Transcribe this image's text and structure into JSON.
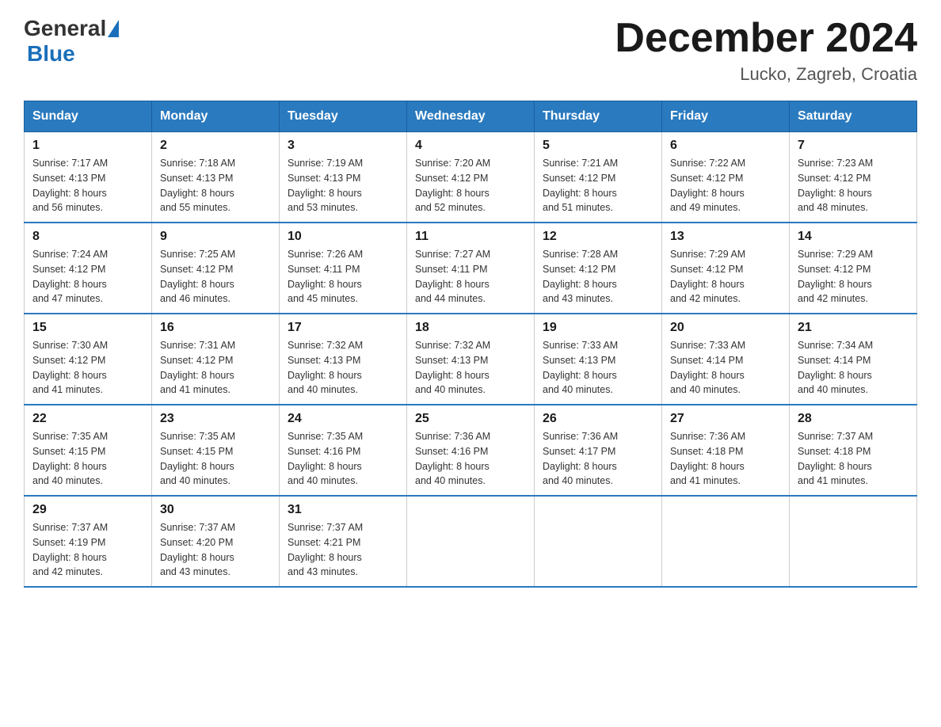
{
  "header": {
    "logo_general": "General",
    "logo_blue": "Blue",
    "title": "December 2024",
    "location": "Lucko, Zagreb, Croatia"
  },
  "calendar": {
    "days_of_week": [
      "Sunday",
      "Monday",
      "Tuesday",
      "Wednesday",
      "Thursday",
      "Friday",
      "Saturday"
    ],
    "weeks": [
      [
        {
          "date": "1",
          "sunrise": "7:17 AM",
          "sunset": "4:13 PM",
          "daylight": "8 hours and 56 minutes."
        },
        {
          "date": "2",
          "sunrise": "7:18 AM",
          "sunset": "4:13 PM",
          "daylight": "8 hours and 55 minutes."
        },
        {
          "date": "3",
          "sunrise": "7:19 AM",
          "sunset": "4:13 PM",
          "daylight": "8 hours and 53 minutes."
        },
        {
          "date": "4",
          "sunrise": "7:20 AM",
          "sunset": "4:12 PM",
          "daylight": "8 hours and 52 minutes."
        },
        {
          "date": "5",
          "sunrise": "7:21 AM",
          "sunset": "4:12 PM",
          "daylight": "8 hours and 51 minutes."
        },
        {
          "date": "6",
          "sunrise": "7:22 AM",
          "sunset": "4:12 PM",
          "daylight": "8 hours and 49 minutes."
        },
        {
          "date": "7",
          "sunrise": "7:23 AM",
          "sunset": "4:12 PM",
          "daylight": "8 hours and 48 minutes."
        }
      ],
      [
        {
          "date": "8",
          "sunrise": "7:24 AM",
          "sunset": "4:12 PM",
          "daylight": "8 hours and 47 minutes."
        },
        {
          "date": "9",
          "sunrise": "7:25 AM",
          "sunset": "4:12 PM",
          "daylight": "8 hours and 46 minutes."
        },
        {
          "date": "10",
          "sunrise": "7:26 AM",
          "sunset": "4:11 PM",
          "daylight": "8 hours and 45 minutes."
        },
        {
          "date": "11",
          "sunrise": "7:27 AM",
          "sunset": "4:11 PM",
          "daylight": "8 hours and 44 minutes."
        },
        {
          "date": "12",
          "sunrise": "7:28 AM",
          "sunset": "4:12 PM",
          "daylight": "8 hours and 43 minutes."
        },
        {
          "date": "13",
          "sunrise": "7:29 AM",
          "sunset": "4:12 PM",
          "daylight": "8 hours and 42 minutes."
        },
        {
          "date": "14",
          "sunrise": "7:29 AM",
          "sunset": "4:12 PM",
          "daylight": "8 hours and 42 minutes."
        }
      ],
      [
        {
          "date": "15",
          "sunrise": "7:30 AM",
          "sunset": "4:12 PM",
          "daylight": "8 hours and 41 minutes."
        },
        {
          "date": "16",
          "sunrise": "7:31 AM",
          "sunset": "4:12 PM",
          "daylight": "8 hours and 41 minutes."
        },
        {
          "date": "17",
          "sunrise": "7:32 AM",
          "sunset": "4:13 PM",
          "daylight": "8 hours and 40 minutes."
        },
        {
          "date": "18",
          "sunrise": "7:32 AM",
          "sunset": "4:13 PM",
          "daylight": "8 hours and 40 minutes."
        },
        {
          "date": "19",
          "sunrise": "7:33 AM",
          "sunset": "4:13 PM",
          "daylight": "8 hours and 40 minutes."
        },
        {
          "date": "20",
          "sunrise": "7:33 AM",
          "sunset": "4:14 PM",
          "daylight": "8 hours and 40 minutes."
        },
        {
          "date": "21",
          "sunrise": "7:34 AM",
          "sunset": "4:14 PM",
          "daylight": "8 hours and 40 minutes."
        }
      ],
      [
        {
          "date": "22",
          "sunrise": "7:35 AM",
          "sunset": "4:15 PM",
          "daylight": "8 hours and 40 minutes."
        },
        {
          "date": "23",
          "sunrise": "7:35 AM",
          "sunset": "4:15 PM",
          "daylight": "8 hours and 40 minutes."
        },
        {
          "date": "24",
          "sunrise": "7:35 AM",
          "sunset": "4:16 PM",
          "daylight": "8 hours and 40 minutes."
        },
        {
          "date": "25",
          "sunrise": "7:36 AM",
          "sunset": "4:16 PM",
          "daylight": "8 hours and 40 minutes."
        },
        {
          "date": "26",
          "sunrise": "7:36 AM",
          "sunset": "4:17 PM",
          "daylight": "8 hours and 40 minutes."
        },
        {
          "date": "27",
          "sunrise": "7:36 AM",
          "sunset": "4:18 PM",
          "daylight": "8 hours and 41 minutes."
        },
        {
          "date": "28",
          "sunrise": "7:37 AM",
          "sunset": "4:18 PM",
          "daylight": "8 hours and 41 minutes."
        }
      ],
      [
        {
          "date": "29",
          "sunrise": "7:37 AM",
          "sunset": "4:19 PM",
          "daylight": "8 hours and 42 minutes."
        },
        {
          "date": "30",
          "sunrise": "7:37 AM",
          "sunset": "4:20 PM",
          "daylight": "8 hours and 43 minutes."
        },
        {
          "date": "31",
          "sunrise": "7:37 AM",
          "sunset": "4:21 PM",
          "daylight": "8 hours and 43 minutes."
        },
        null,
        null,
        null,
        null
      ]
    ],
    "labels": {
      "sunrise": "Sunrise:",
      "sunset": "Sunset:",
      "daylight": "Daylight:"
    }
  }
}
